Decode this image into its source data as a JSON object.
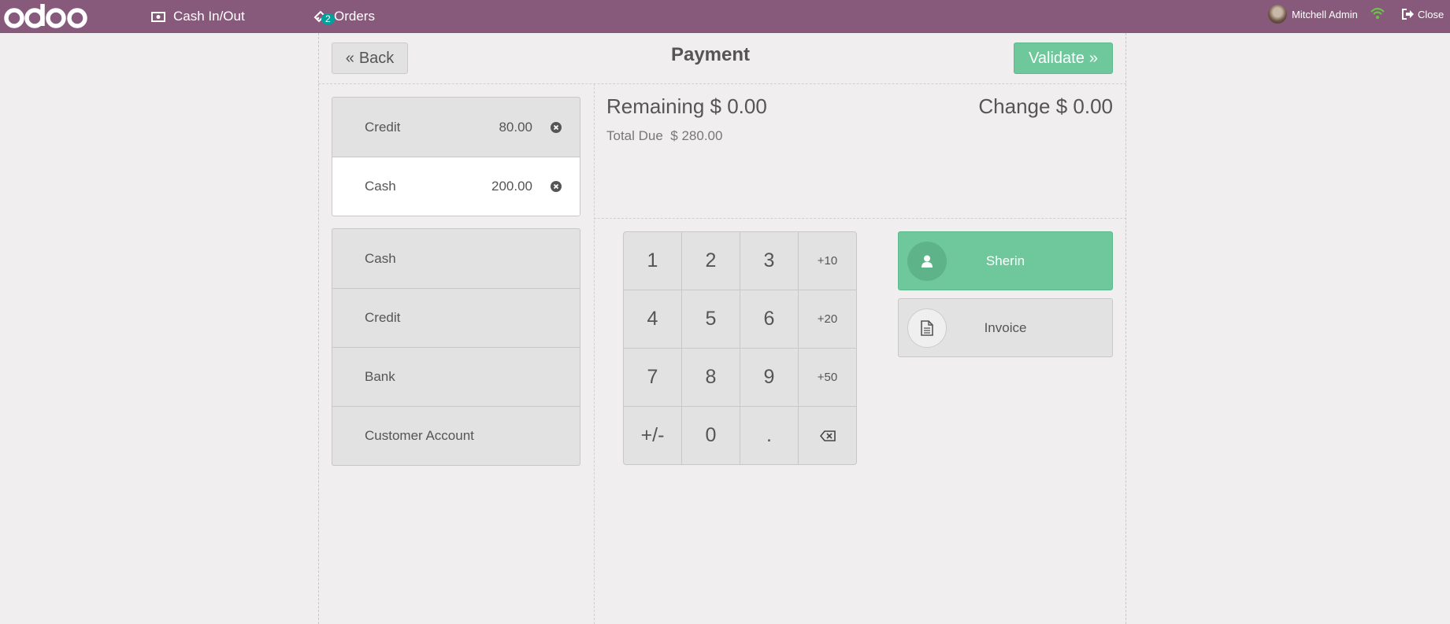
{
  "topbar": {
    "brand": "odoo",
    "cash_in_out": "Cash In/Out",
    "orders": "Orders",
    "orders_badge": "2",
    "user_name": "Mitchell Admin",
    "close": "Close",
    "colors": {
      "bar": "#875a7b",
      "badge": "#00a09d",
      "wifi": "#6cc24a"
    }
  },
  "header": {
    "back": "Back",
    "title": "Payment",
    "validate": "Validate"
  },
  "payment_lines": [
    {
      "method": "Credit",
      "amount": "80.00",
      "selected": false
    },
    {
      "method": "Cash",
      "amount": "200.00",
      "selected": true
    }
  ],
  "payment_methods": [
    {
      "label": "Cash"
    },
    {
      "label": "Credit"
    },
    {
      "label": "Bank"
    },
    {
      "label": "Customer Account"
    }
  ],
  "summary": {
    "remaining_label": "Remaining",
    "remaining_value": "$ 0.00",
    "change_label": "Change",
    "change_value": "$ 0.00",
    "total_due_label": "Total Due",
    "total_due_value": "$ 280.00"
  },
  "numpad": {
    "keys": [
      "1",
      "2",
      "3",
      "+10",
      "4",
      "5",
      "6",
      "+20",
      "7",
      "8",
      "9",
      "+50",
      "+/-",
      "0",
      "."
    ]
  },
  "actions": {
    "customer": "Sherin",
    "invoice": "Invoice",
    "customer_color": "#6ec89b"
  }
}
